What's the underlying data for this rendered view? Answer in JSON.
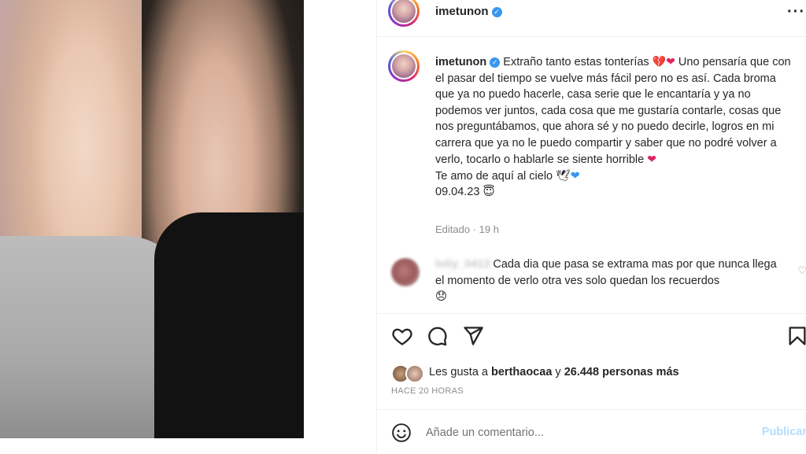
{
  "post": {
    "username": "imetunon",
    "caption_user": "imetunon",
    "caption_text": "Extraño tanto estas tonterías",
    "caption_body": "Uno pensaría que con el pasar del tiempo se vuelve más fácil pero no es así. Cada broma que ya no puedo hacerle, casa serie que le encantaría y ya no podemos ver juntos, cada cosa que me gustaría contarle, cosas que nos preguntábamos, que ahora sé y no puedo decirle, logros en mi carrera que ya no le puedo compartir y saber que no podré volver a verlo, tocarlo o hablarle se siente horrible",
    "caption_line2": "Te amo de aquí al cielo",
    "caption_date": "09.04.23",
    "meta": "Editado · 19 h"
  },
  "comment": {
    "username": "loliy_0413",
    "text": "Cada dia que pasa se extrama mas por que nunca llega el momento de verlo otra ves solo quedan los recuerdos"
  },
  "likes": {
    "prefix": "Les gusta a",
    "user": "berthaocaa",
    "joiner": "y",
    "count": "26.448 personas más"
  },
  "time": "HACE 20 HORAS",
  "add_comment": {
    "placeholder": "Añade un comentario...",
    "publish": "Publicar"
  },
  "colors": {
    "verified": "#3897f0",
    "heart": "#e0245e",
    "muted": "#8e8e8e",
    "publish": "#b2dffc"
  },
  "icons": [
    "verified-icon",
    "more-icon",
    "heart-icon",
    "comment-icon",
    "share-icon",
    "bookmark-icon",
    "emoji-icon"
  ]
}
